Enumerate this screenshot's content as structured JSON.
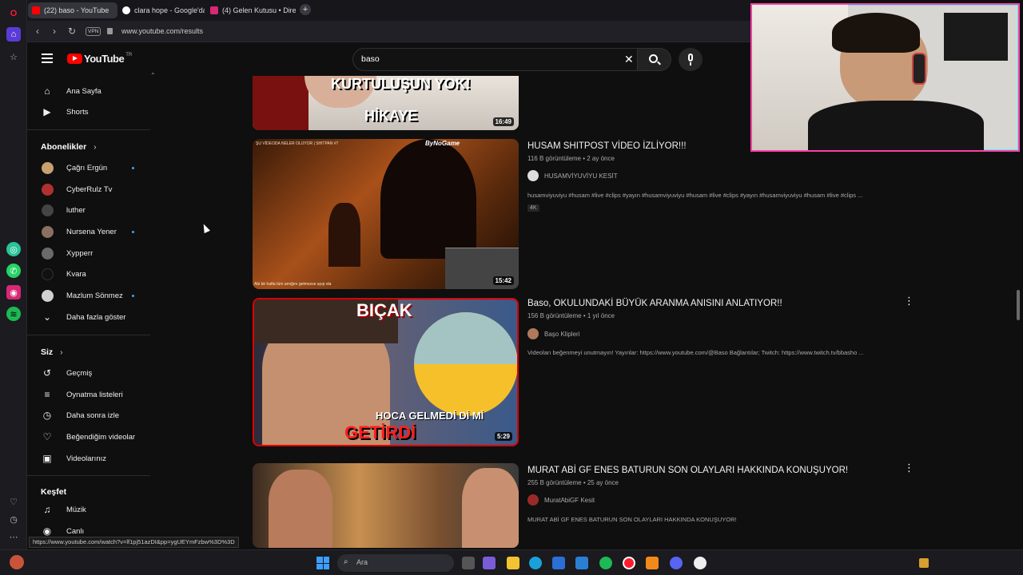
{
  "browser": {
    "tabs": [
      {
        "label": "(22) baso - YouTube",
        "color": "#ff0000"
      },
      {
        "label": "clara hope - Google'da Ara",
        "color": "#4285f4"
      },
      {
        "label": "(4) Gelen Kutusu • Direct",
        "color": "#d62976"
      }
    ],
    "url": "www.youtube.com/results",
    "vpn_label": "VPN",
    "status_url": "https://www.youtube.com/watch?v=lf1pj51azDI&pp=ygUEYmFzbw%3D%3D"
  },
  "youtube": {
    "logo_text": "YouTube",
    "logo_region": "TR",
    "search_value": "baso"
  },
  "sidebar": {
    "main": [
      {
        "label": "Ana Sayfa",
        "icon": "home-icon"
      },
      {
        "label": "Shorts",
        "icon": "shorts-icon"
      }
    ],
    "subs_header": "Abonelikler",
    "subscriptions": [
      {
        "label": "Çağrı Ergün",
        "live": true,
        "color": "#c8a070"
      },
      {
        "label": "CyberRulz Tv",
        "live": false,
        "color": "#b03030"
      },
      {
        "label": "luther",
        "live": false,
        "color": "#444444"
      },
      {
        "label": "Nursena Yener",
        "live": true,
        "color": "#8a7060"
      },
      {
        "label": "Xypperr",
        "live": false,
        "color": "#6a6a6a"
      },
      {
        "label": "Kvara",
        "live": false,
        "color": "#111111"
      },
      {
        "label": "Mazlum Sönmez",
        "live": true,
        "color": "#d0d0d0"
      }
    ],
    "show_more": "Daha fazla göster",
    "you_header": "Siz",
    "you_items": [
      {
        "label": "Geçmiş",
        "icon": "history-icon"
      },
      {
        "label": "Oynatma listeleri",
        "icon": "playlist-icon"
      },
      {
        "label": "Daha sonra izle",
        "icon": "clock-icon"
      },
      {
        "label": "Beğendiğim videolar",
        "icon": "thumbs-up-icon"
      },
      {
        "label": "Videolarınız",
        "icon": "video-icon"
      }
    ],
    "explore_header": "Keşfet",
    "explore_items": [
      {
        "label": "Müzik",
        "icon": "music-icon"
      },
      {
        "label": "Canlı",
        "icon": "live-icon"
      }
    ]
  },
  "results": [
    {
      "thumb_text_1": "KURTULUŞUN YOK!",
      "thumb_text_2": "HİKAYE",
      "duration": "16:49"
    },
    {
      "title": "HUSAM SHITPOST VİDEO İZLİYOR!!!",
      "meta": "116 B görüntüleme • 2 ay önce",
      "channel": "HUSAMVİYUVİYU KESİT",
      "desc": "husamviyuviyu #husam #live #clips #yayın #husamviyuviyu #husam #live #clips #yayın #husamviyuviyu #husam #live #clips ...",
      "badge": "4K",
      "duration": "15:42",
      "thumb_watermark": "ByNoGame",
      "thumb_caption": "ŞU VİDEODA NELER OLUYOR | SHITPAN #7",
      "thumb_bottom": "Abi bir hafta tüm amığını getmezse ayıp ola"
    },
    {
      "title": "Baso, OKULUNDAKİ BÜYÜK ARANMA ANISINI ANLATIYOR!!",
      "meta": "156 B görüntüleme • 1 yıl önce",
      "channel": "Başo Klipleri",
      "desc": "Videoları beğenmeyi unutmayın! Yayınlar: https://www.youtube.com/@Baso Bağlantılar; Twitch: https://www.twitch.tv/bbasho ...",
      "duration": "5:29",
      "thumb_text_1": "BIÇAK",
      "thumb_text_2": "HOCA GELMEDİ Dİ Mİ",
      "thumb_text_3": "GETİRDİ"
    },
    {
      "title": "MURAT ABİ GF ENES BATURUN SON OLAYLARI HAKKINDA KONUŞUYOR!",
      "meta": "255 B görüntüleme • 25 ay önce",
      "channel": "MuratAbiGF Kesit",
      "desc": "MURAT ABİ GF ENES BATURUN SON OLAYLARI HAKKINDA KONUŞUYOR!"
    }
  ],
  "taskbar": {
    "search_placeholder": "Ara"
  }
}
